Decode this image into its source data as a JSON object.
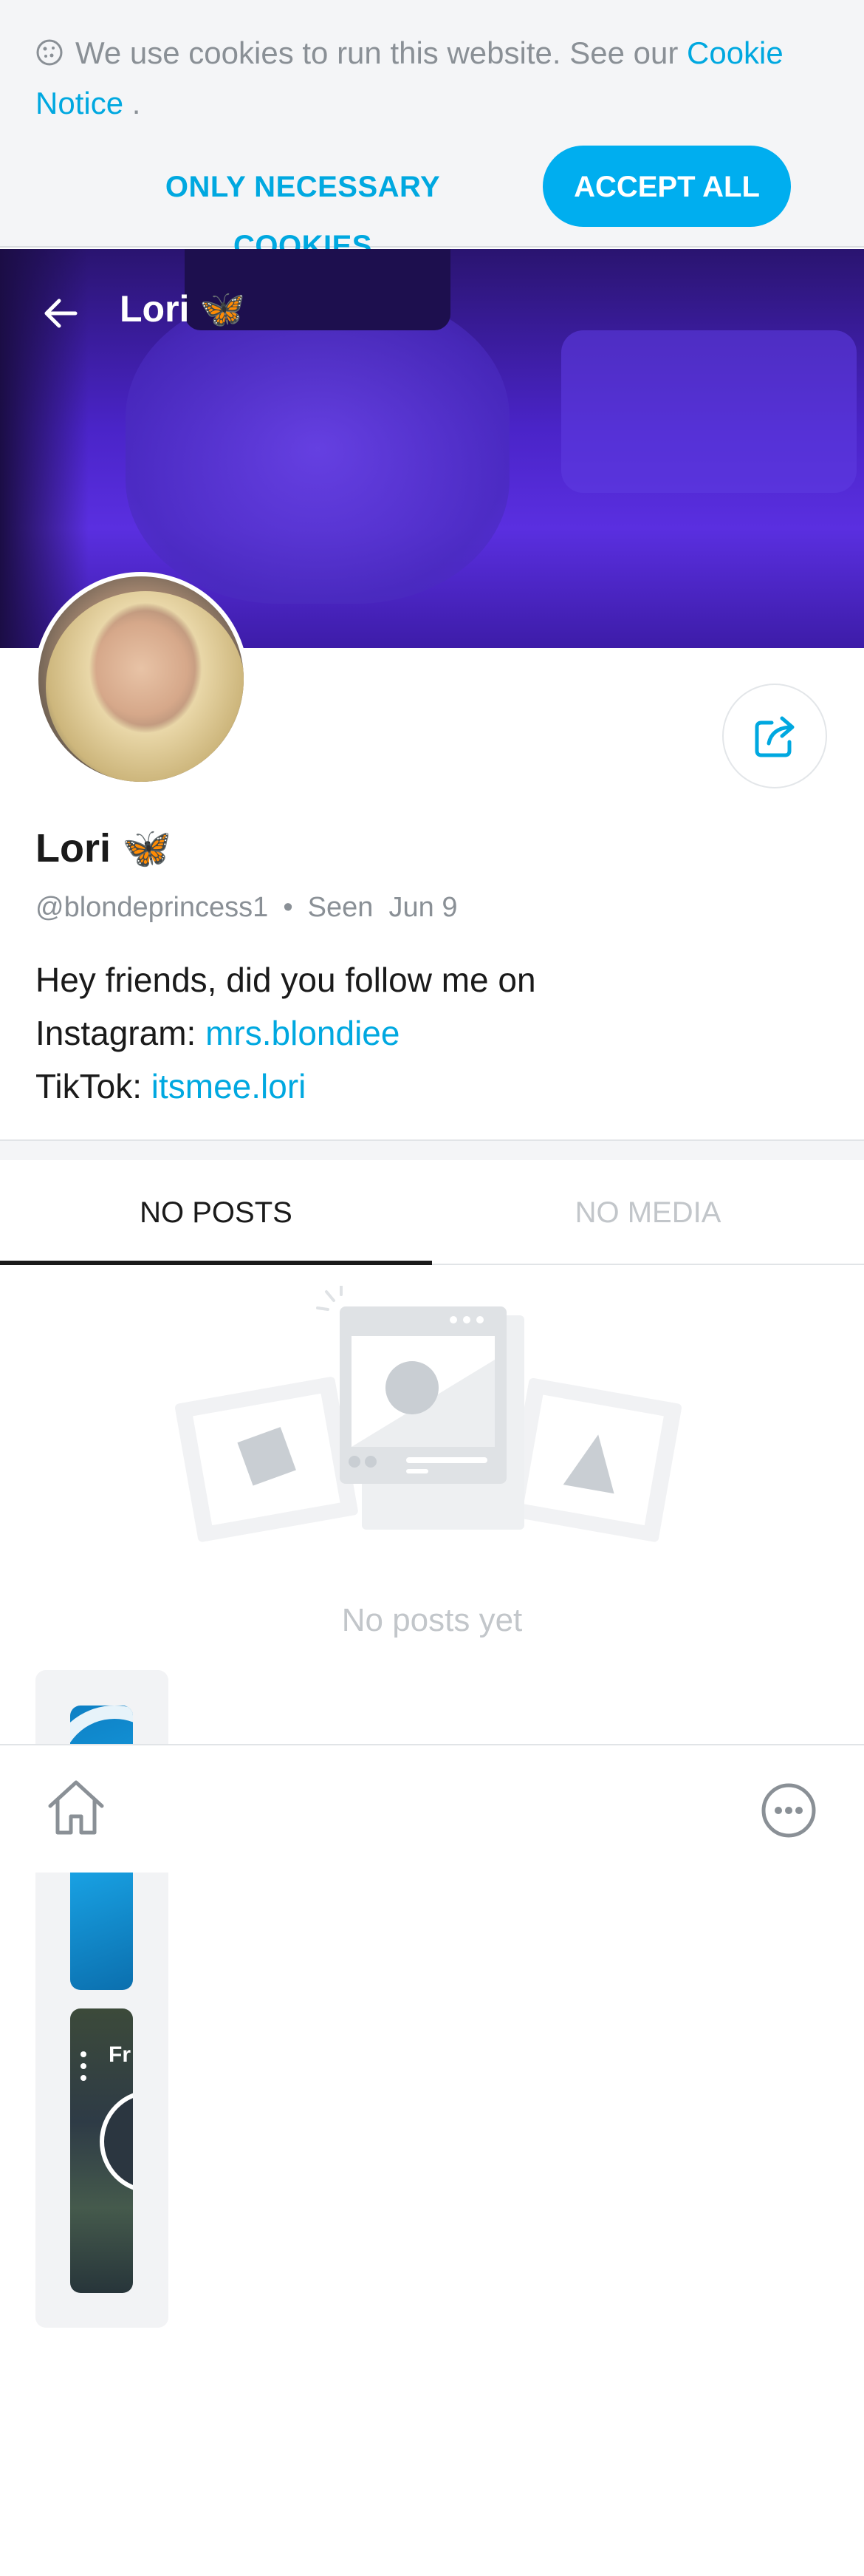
{
  "cookie_banner": {
    "text": "We use cookies to run this website. See our",
    "link_text": "Cookie Notice",
    "suffix": " .",
    "necessary_label": "ONLY NECESSARY COOKIES",
    "accept_label": "ACCEPT ALL",
    "icon": "cookie-icon"
  },
  "header": {
    "back_icon": "arrow-left-icon",
    "title": "Lori 🦋"
  },
  "profile": {
    "name": "Lori 🦋",
    "handle": "@blondeprincess1",
    "separator": "•",
    "seen_label": "Seen",
    "seen_date": "Jun 9",
    "bio_line1": "Hey friends, did you follow me on",
    "bio_instagram_prefix": "Instagram: ",
    "bio_instagram_link": "mrs.blondiee",
    "bio_tiktok_prefix": "TikTok: ",
    "bio_tiktok_link": "itsmee.lori",
    "share_icon": "share-icon"
  },
  "tabs": [
    {
      "label": "NO POSTS",
      "active": true
    },
    {
      "label": "NO MEDIA",
      "active": false
    }
  ],
  "empty_state": {
    "text": "No posts yet"
  },
  "side_card": {
    "label": "Fr"
  },
  "bottom_nav": {
    "home_icon": "home-icon",
    "more_icon": "more-icon"
  },
  "colors": {
    "accent": "#00aeef",
    "link": "#00a8e0",
    "muted": "#8a9096",
    "disabled": "#c2c6ca"
  }
}
